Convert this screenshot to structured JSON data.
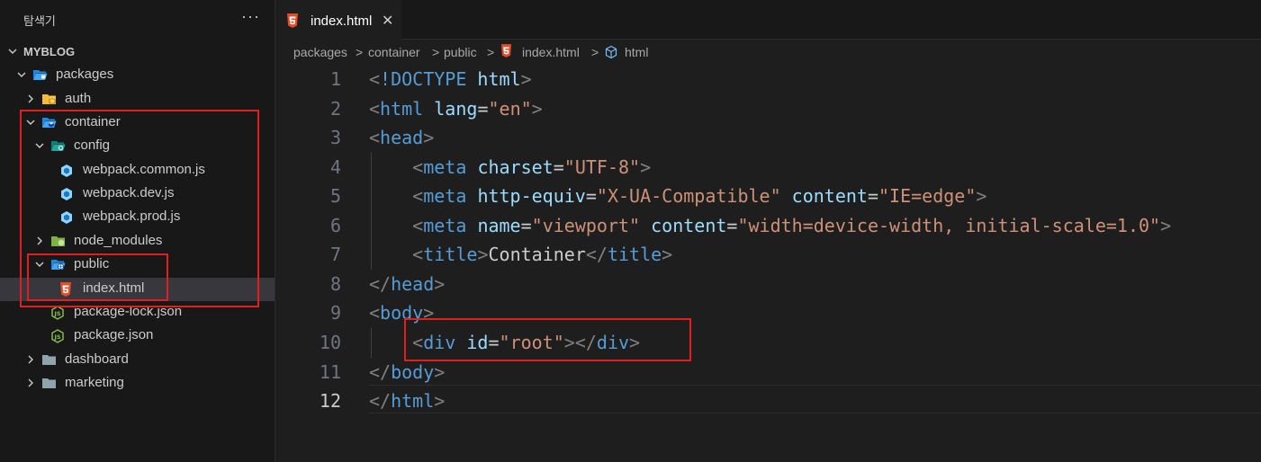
{
  "sidebar": {
    "title": "탐색기",
    "more": "···",
    "tree": [
      {
        "label": "MYBLOG",
        "chevron": "down",
        "icon": "none"
      },
      {
        "label": "packages",
        "chevron": "down",
        "icon": "folder-packages-open-icon"
      },
      {
        "label": "auth",
        "chevron": "right",
        "icon": "folder-lock-icon"
      },
      {
        "label": "container",
        "chevron": "down",
        "icon": "folder-container-open-icon"
      },
      {
        "label": "config",
        "chevron": "down",
        "icon": "folder-config-open-icon"
      },
      {
        "label": "webpack.common.js",
        "chevron": "none",
        "icon": "webpack-icon"
      },
      {
        "label": "webpack.dev.js",
        "chevron": "none",
        "icon": "webpack-icon"
      },
      {
        "label": "webpack.prod.js",
        "chevron": "none",
        "icon": "webpack-icon"
      },
      {
        "label": "node_modules",
        "chevron": "right",
        "icon": "folder-node-icon"
      },
      {
        "label": "public",
        "chevron": "down",
        "icon": "folder-public-open-icon"
      },
      {
        "label": "index.html",
        "chevron": "none",
        "icon": "html5-icon"
      },
      {
        "label": "package-lock.json",
        "chevron": "none",
        "icon": "nodejs-icon"
      },
      {
        "label": "package.json",
        "chevron": "none",
        "icon": "nodejs-icon"
      },
      {
        "label": "dashboard",
        "chevron": "right",
        "icon": "folder-icon"
      },
      {
        "label": "marketing",
        "chevron": "right",
        "icon": "folder-icon"
      }
    ]
  },
  "tab": {
    "label": "index.html",
    "close": "✕"
  },
  "breadcrumb": {
    "items": [
      "packages",
      "container",
      "public",
      "index.html",
      "html"
    ],
    "separator": ">"
  },
  "editor": {
    "active_line": 12,
    "lines": [
      {
        "n": "1",
        "tokens": [
          [
            "b",
            "<"
          ],
          [
            "t",
            "!DOCTYPE"
          ],
          [
            "p",
            " "
          ],
          [
            "a",
            "html"
          ],
          [
            "b",
            ">"
          ]
        ]
      },
      {
        "n": "2",
        "tokens": [
          [
            "b",
            "<"
          ],
          [
            "t",
            "html"
          ],
          [
            "p",
            " "
          ],
          [
            "a",
            "lang"
          ],
          [
            "p",
            "="
          ],
          [
            "s",
            "\"en\""
          ],
          [
            "b",
            ">"
          ]
        ]
      },
      {
        "n": "3",
        "tokens": [
          [
            "b",
            "<"
          ],
          [
            "t",
            "head"
          ],
          [
            "b",
            ">"
          ]
        ]
      },
      {
        "n": "4",
        "tokens": [
          [
            "p",
            "    "
          ],
          [
            "b",
            "<"
          ],
          [
            "t",
            "meta"
          ],
          [
            "p",
            " "
          ],
          [
            "a",
            "charset"
          ],
          [
            "p",
            "="
          ],
          [
            "s",
            "\"UTF-8\""
          ],
          [
            "b",
            ">"
          ]
        ]
      },
      {
        "n": "5",
        "tokens": [
          [
            "p",
            "    "
          ],
          [
            "b",
            "<"
          ],
          [
            "t",
            "meta"
          ],
          [
            "p",
            " "
          ],
          [
            "a",
            "http-equiv"
          ],
          [
            "p",
            "="
          ],
          [
            "s",
            "\"X-UA-Compatible\""
          ],
          [
            "p",
            " "
          ],
          [
            "a",
            "content"
          ],
          [
            "p",
            "="
          ],
          [
            "s",
            "\"IE=edge\""
          ],
          [
            "b",
            ">"
          ]
        ]
      },
      {
        "n": "6",
        "tokens": [
          [
            "p",
            "    "
          ],
          [
            "b",
            "<"
          ],
          [
            "t",
            "meta"
          ],
          [
            "p",
            " "
          ],
          [
            "a",
            "name"
          ],
          [
            "p",
            "="
          ],
          [
            "s",
            "\"viewport\""
          ],
          [
            "p",
            " "
          ],
          [
            "a",
            "content"
          ],
          [
            "p",
            "="
          ],
          [
            "s",
            "\"width=device-width, initial-scale=1.0\""
          ],
          [
            "b",
            ">"
          ]
        ]
      },
      {
        "n": "7",
        "tokens": [
          [
            "p",
            "    "
          ],
          [
            "b",
            "<"
          ],
          [
            "t",
            "title"
          ],
          [
            "b",
            ">"
          ],
          [
            "p",
            "Container"
          ],
          [
            "b",
            "</"
          ],
          [
            "t",
            "title"
          ],
          [
            "b",
            ">"
          ]
        ]
      },
      {
        "n": "8",
        "tokens": [
          [
            "b",
            "</"
          ],
          [
            "t",
            "head"
          ],
          [
            "b",
            ">"
          ]
        ]
      },
      {
        "n": "9",
        "tokens": [
          [
            "b",
            "<"
          ],
          [
            "t",
            "body"
          ],
          [
            "b",
            ">"
          ]
        ]
      },
      {
        "n": "10",
        "tokens": [
          [
            "p",
            "    "
          ],
          [
            "b",
            "<"
          ],
          [
            "t",
            "div"
          ],
          [
            "p",
            " "
          ],
          [
            "a",
            "id"
          ],
          [
            "p",
            "="
          ],
          [
            "s",
            "\"root\""
          ],
          [
            "b",
            "></"
          ],
          [
            "t",
            "div"
          ],
          [
            "b",
            ">"
          ]
        ]
      },
      {
        "n": "11",
        "tokens": [
          [
            "b",
            "</"
          ],
          [
            "t",
            "body"
          ],
          [
            "b",
            ">"
          ]
        ]
      },
      {
        "n": "12",
        "tokens": [
          [
            "b",
            "</"
          ],
          [
            "t",
            "html"
          ],
          [
            "b",
            ">"
          ]
        ]
      }
    ]
  },
  "colors": {
    "annotation": "#e02020",
    "tag": "#569cd6",
    "attribute": "#9cdcfe",
    "string": "#ce9178",
    "html5": "#e44d26",
    "folder_blue": "#42a5f5",
    "folder_yellow": "#f9b93a",
    "folder_green": "#8bc34a",
    "nodejs": "#8bc34a"
  }
}
